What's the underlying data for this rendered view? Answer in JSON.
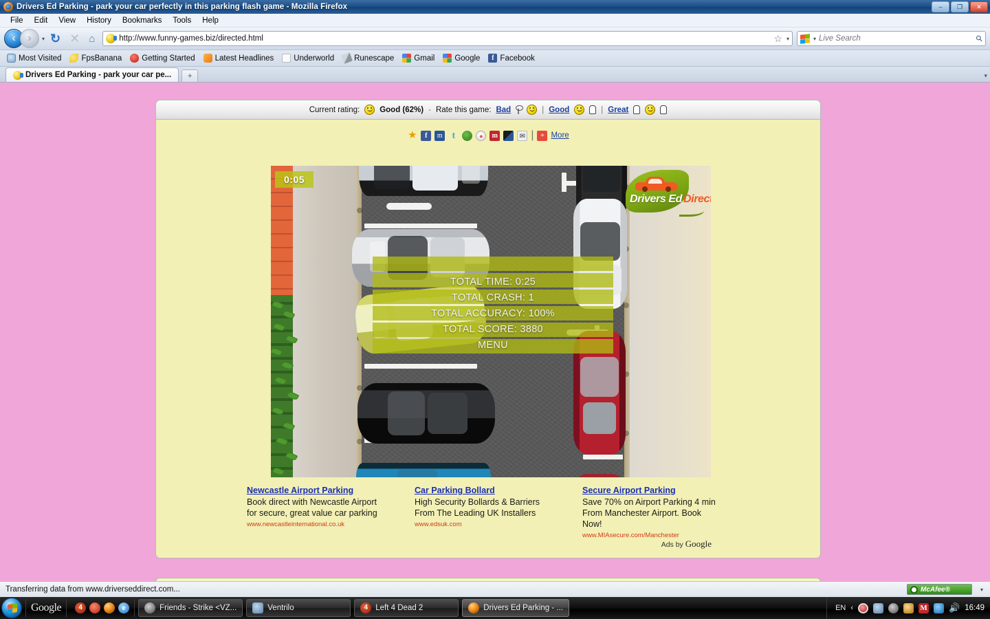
{
  "window": {
    "title": "Drivers Ed Parking - park your car perfectly in this parking flash game - Mozilla Firefox",
    "minimize": "–",
    "maximize": "❐",
    "close": "✕"
  },
  "menubar": [
    "File",
    "Edit",
    "View",
    "History",
    "Bookmarks",
    "Tools",
    "Help"
  ],
  "toolbar": {
    "back": "‹",
    "forward": "›",
    "dropdown": "▾",
    "reload": "↻",
    "stop": "✕",
    "home": "⌂",
    "url": "http://www.funny-games.biz/directed.html",
    "star": "☆",
    "search_placeholder": "Live Search",
    "search_value": "",
    "magnifier": "⚲"
  },
  "bookmarks": [
    {
      "label": "Most Visited",
      "icon": "ico-mv"
    },
    {
      "label": "FpsBanana",
      "icon": "ico-banana"
    },
    {
      "label": "Getting Started",
      "icon": "ico-red"
    },
    {
      "label": "Latest Headlines",
      "icon": "ico-rss"
    },
    {
      "label": "Underworld",
      "icon": "ico-page"
    },
    {
      "label": "Runescape",
      "icon": "ico-sword"
    },
    {
      "label": "Gmail",
      "icon": "ico-g"
    },
    {
      "label": "Google",
      "icon": "ico-g"
    },
    {
      "label": "Facebook",
      "icon": "ico-fb"
    }
  ],
  "tabs": {
    "active_title": "Drivers Ed Parking - park your car pe...",
    "new_tab": "+",
    "list_all": "▾"
  },
  "rating": {
    "current_label": "Current rating:",
    "value": "Good (62%)",
    "rate_label": "Rate this game:",
    "options": [
      "Bad",
      "Good",
      "Great"
    ],
    "separator": "|",
    "dash": "-"
  },
  "share": {
    "icons": [
      "favorites-star",
      "facebook",
      "myspace",
      "twitter",
      "stumbleupon",
      "reddit",
      "mixx",
      "delicious",
      "email"
    ],
    "separator": "|",
    "more": "More"
  },
  "game": {
    "timer": "0:05",
    "logo_primary": "Drivers Ed",
    "logo_secondary": "Direct",
    "stats": [
      {
        "label": "TOTAL TIME:",
        "value": "0:25"
      },
      {
        "label": "TOTAL CRASH:",
        "value": "1"
      },
      {
        "label": "TOTAL ACCURACY:",
        "value": "100%"
      },
      {
        "label": "TOTAL SCORE:",
        "value": "3880"
      }
    ],
    "menu_label": "MENU",
    "overlay_color": "#b0ba12"
  },
  "ads": {
    "items": [
      {
        "title": "Newcastle Airport Parking",
        "line1": "Book direct with Newcastle Airport",
        "line2": "for secure, great value car parking",
        "line3": "",
        "url": "www.newcastleinternational.co.uk"
      },
      {
        "title": "Car Parking Bollard",
        "line1": "High Security Bollards & Barriers",
        "line2": "From The Leading UK Installers",
        "line3": "",
        "url": "www.edsuk.com"
      },
      {
        "title": "Secure Airport Parking",
        "line1": "Save 70% on Airport Parking 4 min",
        "line2": "From Manchester Airport. Book",
        "line3": "Now!",
        "url": "www.MIAsecure.com/Manchester"
      }
    ],
    "ads_by": "Ads by",
    "ads_by_brand": "Google"
  },
  "statusbar": {
    "text": "Transferring data from www.driverseddirect.com...",
    "mcafee": "McAfee®",
    "mcafee_caret": "▾"
  },
  "taskbar": {
    "quicklaunch_google": "Google",
    "quicklaunch_icons": [
      "left4dead-icon",
      "redthing-icon",
      "firefox-icon",
      "internet-explorer-icon"
    ],
    "buttons": [
      {
        "label": "Friends - Strike <VZ...",
        "icon": "steam-icon",
        "active": false
      },
      {
        "label": "Ventrilo",
        "icon": "ventrilo-icon",
        "active": false
      },
      {
        "label": "Left 4 Dead 2",
        "icon": "left4dead-icon",
        "active": false
      },
      {
        "label": "Drivers Ed Parking - ...",
        "icon": "firefox-icon",
        "active": true
      }
    ],
    "tray": {
      "language": "EN",
      "expand": "‹",
      "icons": [
        "target-icon",
        "user-blocked-icon",
        "steam-icon",
        "ventrilo-icon",
        "mcafee-icon",
        "network-icon",
        "volume-icon"
      ],
      "clock": "16:49"
    }
  }
}
